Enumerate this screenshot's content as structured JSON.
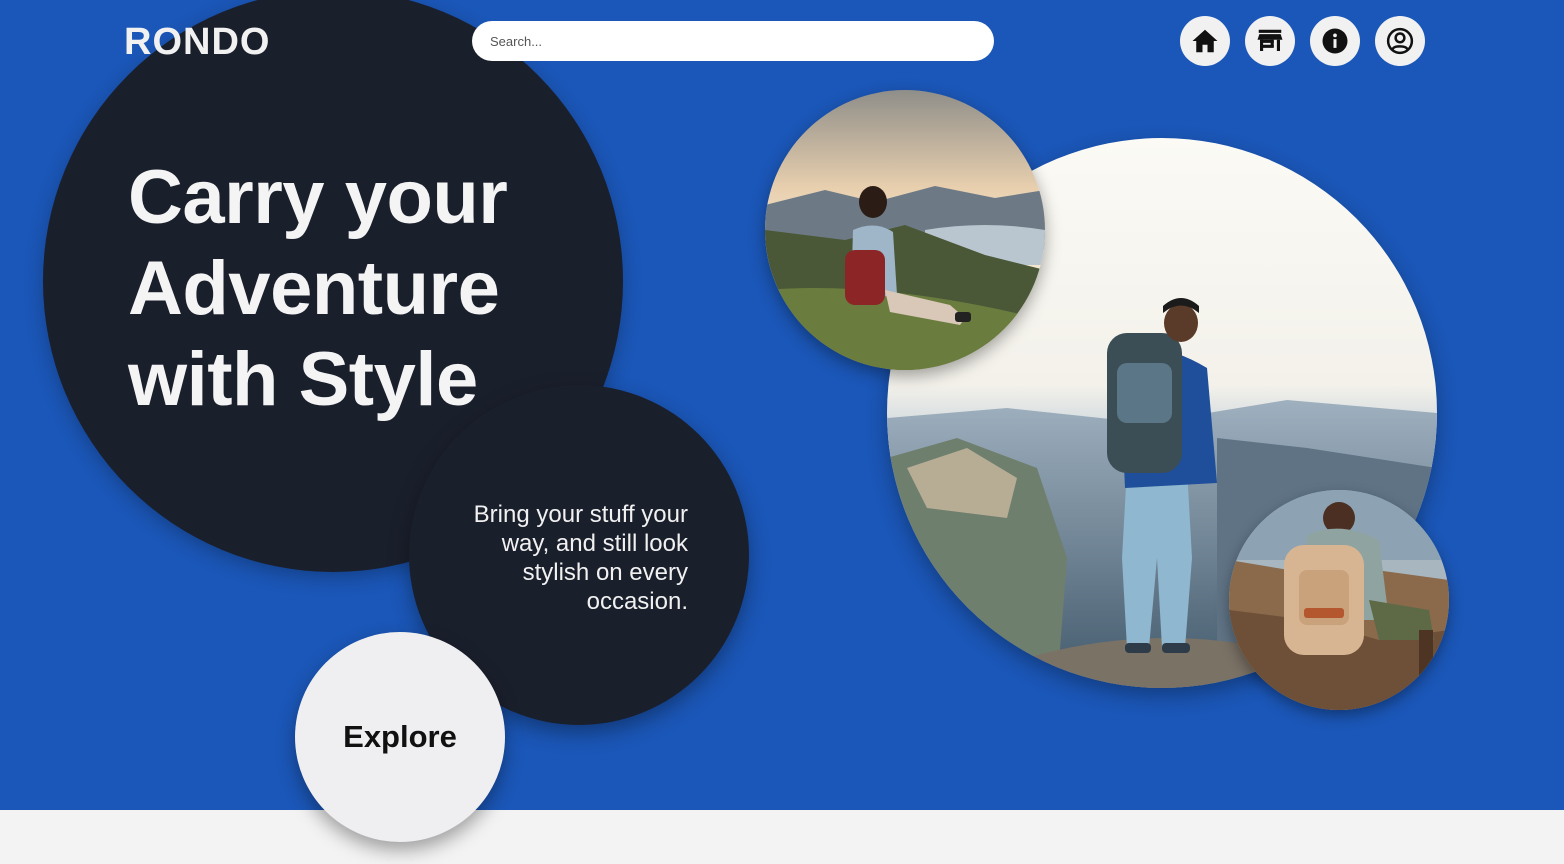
{
  "brand": {
    "name": "RONDO"
  },
  "search": {
    "placeholder": "Search..."
  },
  "nav": [
    {
      "icon": "home-icon"
    },
    {
      "icon": "store-icon"
    },
    {
      "icon": "info-icon"
    },
    {
      "icon": "account-icon"
    }
  ],
  "hero": {
    "headline": "Carry your Adventure with Style",
    "tagline": "Bring your stuff your way, and still look stylish on every occasion.",
    "cta_label": "Explore"
  },
  "colors": {
    "background": "#1b57b8",
    "dark_circle": "#1a1f2c",
    "button": "#efeff1",
    "footer": "#f3f3f3"
  }
}
